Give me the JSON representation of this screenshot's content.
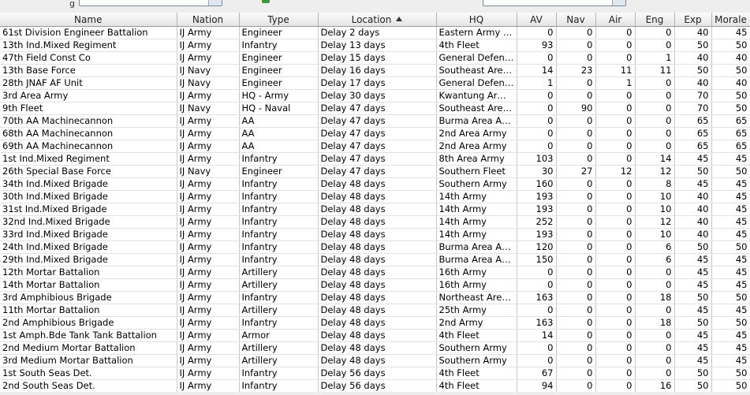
{
  "columns": [
    {
      "key": "name",
      "label": "Name"
    },
    {
      "key": "nation",
      "label": "Nation"
    },
    {
      "key": "type",
      "label": "Type"
    },
    {
      "key": "location",
      "label": "Location"
    },
    {
      "key": "hq",
      "label": "HQ"
    },
    {
      "key": "av",
      "label": "AV"
    },
    {
      "key": "nav",
      "label": "Nav"
    },
    {
      "key": "air",
      "label": "Air"
    },
    {
      "key": "eng",
      "label": "Eng"
    },
    {
      "key": "exp",
      "label": "Exp"
    },
    {
      "key": "morale",
      "label": "Morale"
    }
  ],
  "sort": {
    "column": "location",
    "direction": "ascending",
    "icon": "sort-ascending-icon"
  },
  "rows": [
    [
      "61st Division Engineer Battalion",
      "IJ Army",
      "Engineer",
      "Delay 2 days",
      "Eastern Army (R)",
      "0",
      "0",
      "0",
      "0",
      "40",
      "45"
    ],
    [
      "13th Ind.Mixed Regiment",
      "IJ Army",
      "Infantry",
      "Delay 13 days",
      "4th Fleet",
      "93",
      "0",
      "0",
      "0",
      "50",
      "50"
    ],
    [
      "47th Field Const Co",
      "IJ Army",
      "Engineer",
      "Delay 15 days",
      "General Defenc...",
      "0",
      "0",
      "0",
      "1",
      "40",
      "40"
    ],
    [
      "13th Base Force",
      "IJ Navy",
      "Engineer",
      "Delay 16 days",
      "Southeast Area ...",
      "14",
      "23",
      "11",
      "11",
      "50",
      "50"
    ],
    [
      "28th JNAF AF Unit",
      "IJ Navy",
      "Engineer",
      "Delay 17 days",
      "General Defenc...",
      "1",
      "0",
      "1",
      "0",
      "40",
      "40"
    ],
    [
      "3rd Area Army",
      "IJ Army",
      "HQ - Army",
      "Delay 30 days",
      "Kwantung Army ...",
      "0",
      "0",
      "0",
      "0",
      "70",
      "50"
    ],
    [
      "9th Fleet",
      "IJ Navy",
      "HQ - Naval",
      "Delay 47 days",
      "Southeast Area ...",
      "0",
      "90",
      "0",
      "0",
      "70",
      "50"
    ],
    [
      "70th AA Machinecannon",
      "IJ Army",
      "AA",
      "Delay 47 days",
      "Burma Area Army",
      "0",
      "0",
      "0",
      "0",
      "65",
      "65"
    ],
    [
      "68th AA Machinecannon",
      "IJ Army",
      "AA",
      "Delay 47 days",
      "2nd Area Army",
      "0",
      "0",
      "0",
      "0",
      "65",
      "65"
    ],
    [
      "69th AA Machinecannon",
      "IJ Army",
      "AA",
      "Delay 47 days",
      "2nd Area Army",
      "0",
      "0",
      "0",
      "0",
      "65",
      "65"
    ],
    [
      "1st Ind.Mixed Regiment",
      "IJ Army",
      "Infantry",
      "Delay 47 days",
      "8th Area Army",
      "103",
      "0",
      "0",
      "14",
      "45",
      "45"
    ],
    [
      "26th Special Base Force",
      "IJ Navy",
      "Engineer",
      "Delay 47 days",
      "Southern Fleet",
      "30",
      "27",
      "12",
      "12",
      "50",
      "50"
    ],
    [
      "34th Ind.Mixed Brigade",
      "IJ Army",
      "Infantry",
      "Delay 48 days",
      "Southern Army",
      "160",
      "0",
      "0",
      "8",
      "45",
      "45"
    ],
    [
      "30th Ind.Mixed Brigade",
      "IJ Army",
      "Infantry",
      "Delay 48 days",
      "14th Army",
      "193",
      "0",
      "0",
      "10",
      "40",
      "45"
    ],
    [
      "31st Ind.Mixed Brigade",
      "IJ Army",
      "Infantry",
      "Delay 48 days",
      "14th Army",
      "193",
      "0",
      "0",
      "10",
      "40",
      "45"
    ],
    [
      "32nd Ind.Mixed Brigade",
      "IJ Army",
      "Infantry",
      "Delay 48 days",
      "14th Army",
      "252",
      "0",
      "0",
      "12",
      "40",
      "45"
    ],
    [
      "33rd Ind.Mixed Brigade",
      "IJ Army",
      "Infantry",
      "Delay 48 days",
      "14th Army",
      "193",
      "0",
      "0",
      "10",
      "40",
      "45"
    ],
    [
      "24th Ind.Mixed Brigade",
      "IJ Army",
      "Infantry",
      "Delay 48 days",
      "Burma Area Army",
      "120",
      "0",
      "0",
      "6",
      "50",
      "50"
    ],
    [
      "29th Ind.Mixed Brigade",
      "IJ Army",
      "Infantry",
      "Delay 48 days",
      "Burma Area Army",
      "150",
      "0",
      "0",
      "6",
      "45",
      "45"
    ],
    [
      "12th Mortar Battalion",
      "IJ Army",
      "Artillery",
      "Delay 48 days",
      "16th Army",
      "0",
      "0",
      "0",
      "0",
      "45",
      "45"
    ],
    [
      "14th Mortar Battalion",
      "IJ Army",
      "Artillery",
      "Delay 48 days",
      "16th Army",
      "0",
      "0",
      "0",
      "0",
      "45",
      "45"
    ],
    [
      "3rd Amphibious Brigade",
      "IJ Army",
      "Infantry",
      "Delay 48 days",
      "Northeast Area ...",
      "163",
      "0",
      "0",
      "18",
      "50",
      "50"
    ],
    [
      "11th Mortar Battalion",
      "IJ Army",
      "Artillery",
      "Delay 48 days",
      "25th Army",
      "0",
      "0",
      "0",
      "0",
      "45",
      "45"
    ],
    [
      "2nd Amphibious Brigade",
      "IJ Army",
      "Infantry",
      "Delay 48 days",
      "2nd Army",
      "163",
      "0",
      "0",
      "18",
      "50",
      "50"
    ],
    [
      "1st Amph.Bde Tank Tank Battalion",
      "IJ Army",
      "Armor",
      "Delay 48 days",
      "4th Fleet",
      "14",
      "0",
      "0",
      "0",
      "45",
      "45"
    ],
    [
      "2nd Medium Mortar Battalion",
      "IJ Army",
      "Artillery",
      "Delay 48 days",
      "Southern Army",
      "0",
      "0",
      "0",
      "0",
      "45",
      "45"
    ],
    [
      "3rd Medium Mortar Battalion",
      "IJ Army",
      "Artillery",
      "Delay 48 days",
      "Southern Army",
      "0",
      "0",
      "0",
      "0",
      "45",
      "45"
    ],
    [
      "1st South Seas Det.",
      "IJ Army",
      "Infantry",
      "Delay 56 days",
      "4th Fleet",
      "67",
      "0",
      "0",
      "0",
      "50",
      "50"
    ],
    [
      "2nd South Seas Det.",
      "IJ Army",
      "Infantry",
      "Delay 56 days",
      "4th Fleet",
      "94",
      "0",
      "0",
      "16",
      "50",
      "50"
    ]
  ]
}
